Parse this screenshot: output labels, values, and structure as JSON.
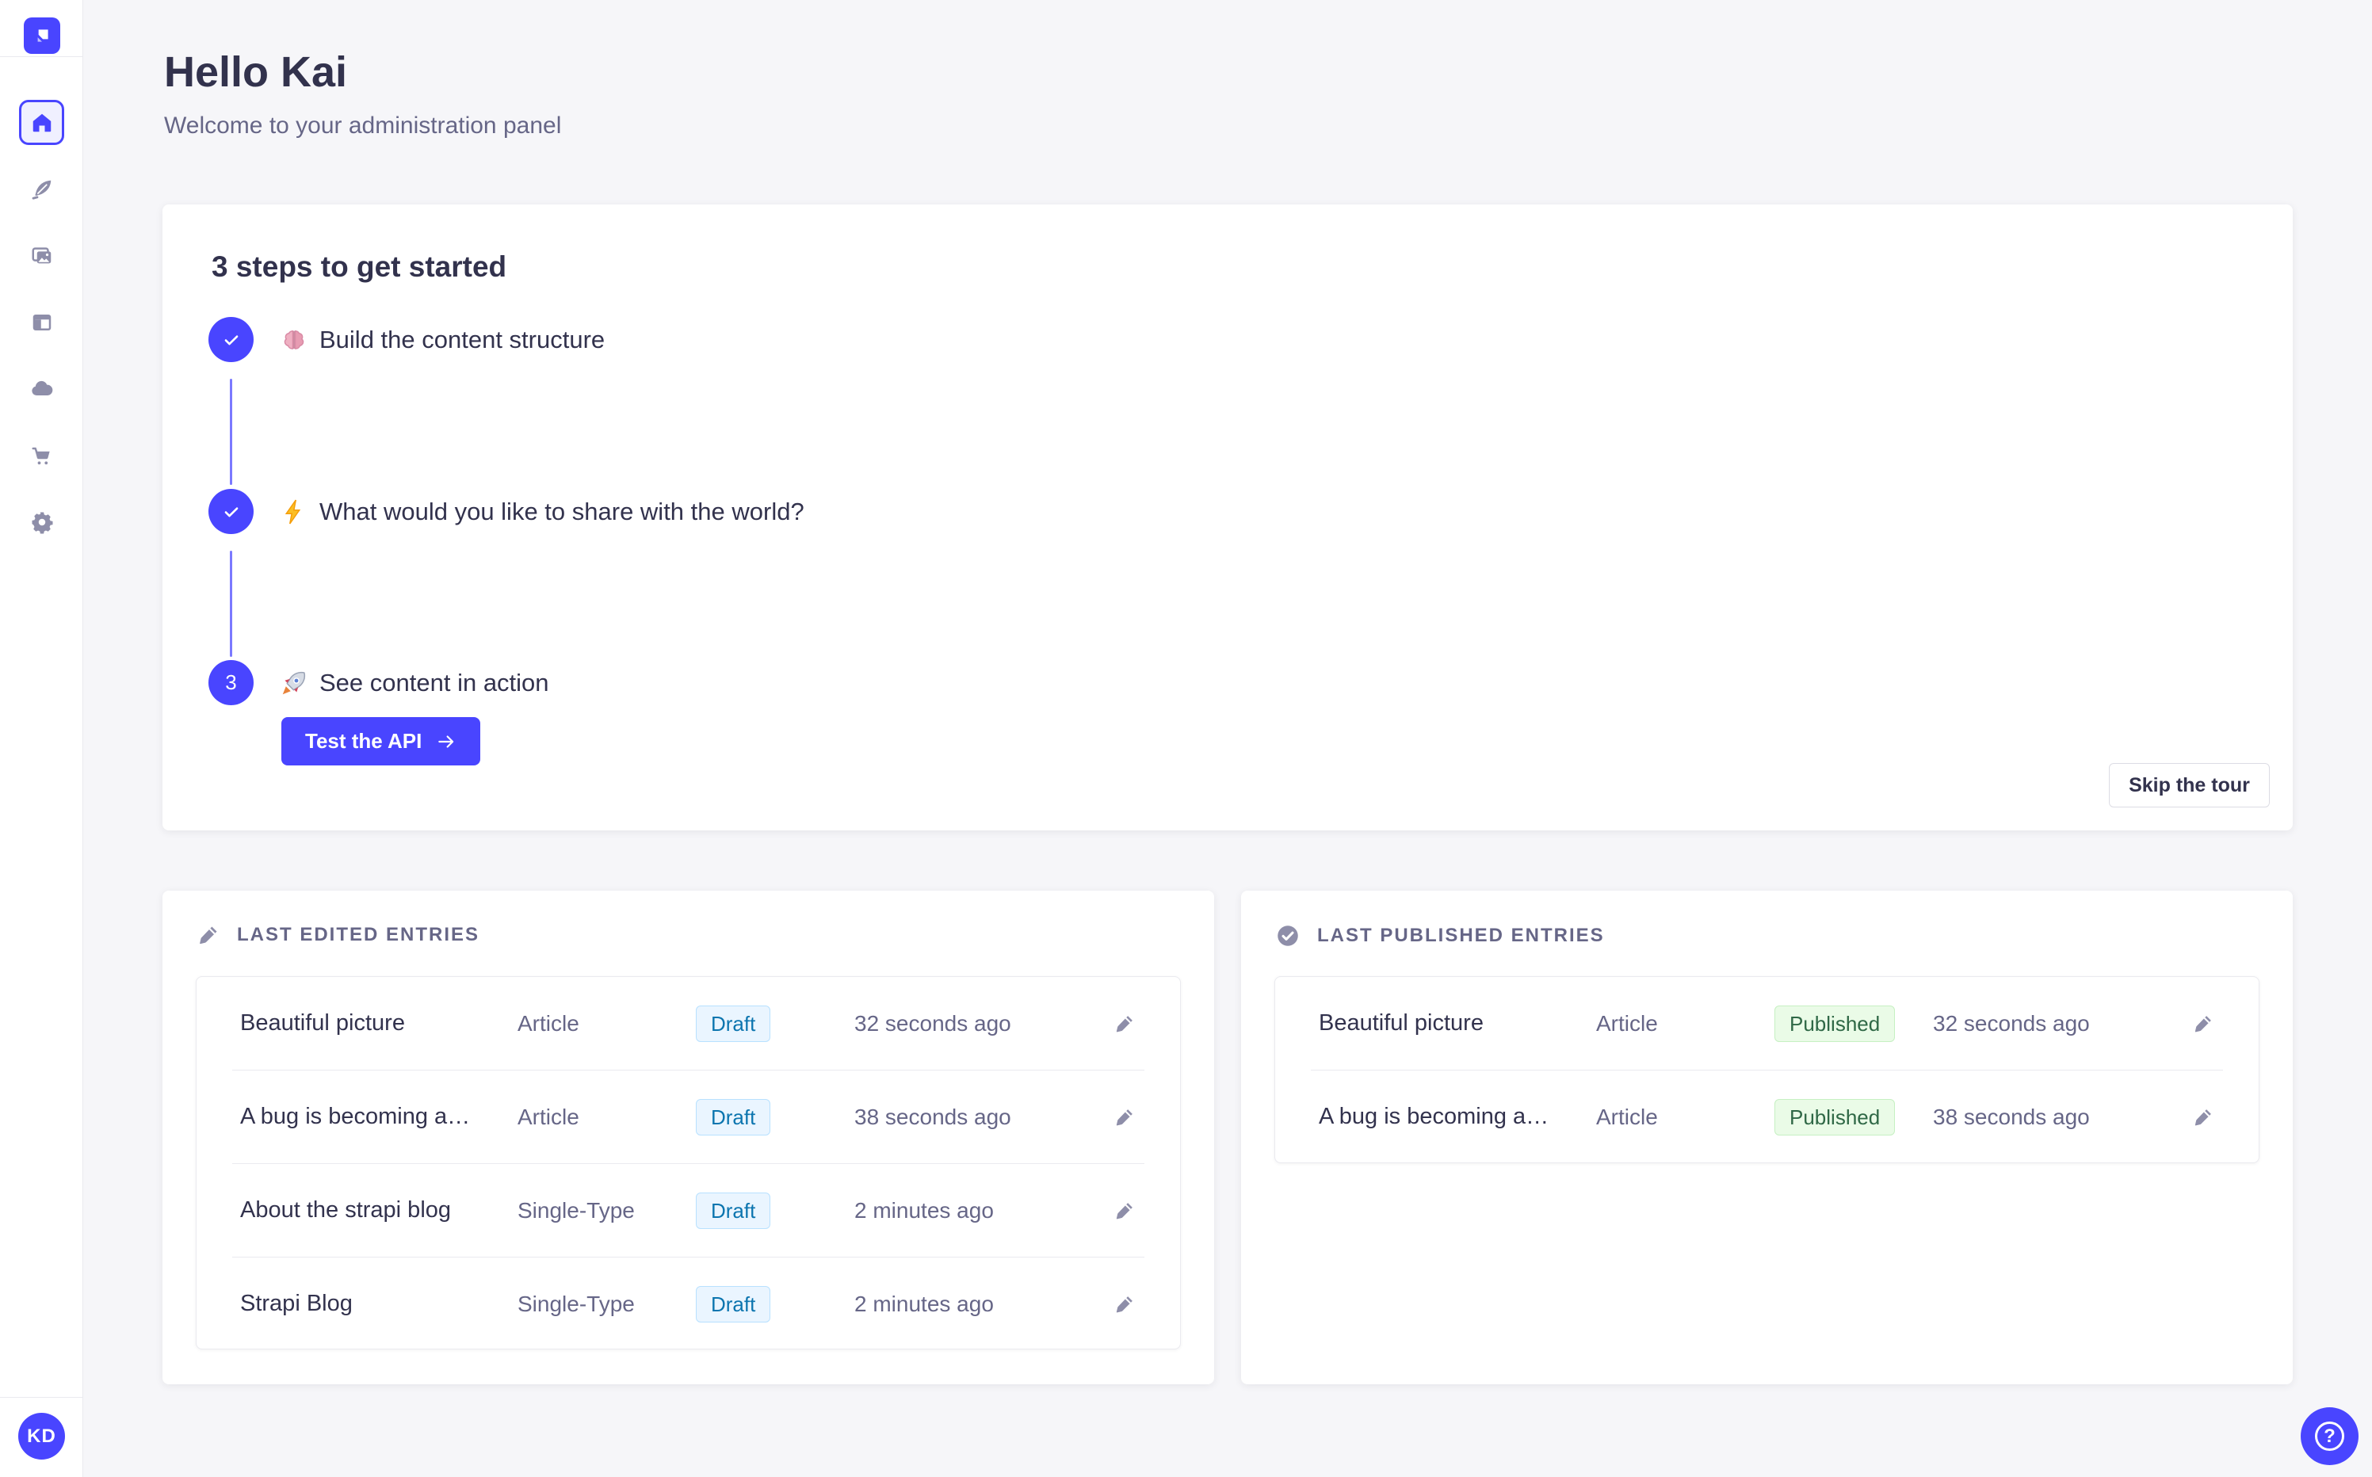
{
  "header": {
    "title": "Hello Kai",
    "subtitle": "Welcome to your administration panel"
  },
  "sidebar": {
    "logo_icon": "strapi-logo",
    "items": [
      {
        "icon": "home-icon",
        "active": true
      },
      {
        "icon": "feather-icon",
        "active": false
      },
      {
        "icon": "images-icon",
        "active": false
      },
      {
        "icon": "layout-icon",
        "active": false
      },
      {
        "icon": "cloud-icon",
        "active": false
      },
      {
        "icon": "cart-icon",
        "active": false
      },
      {
        "icon": "gear-icon",
        "active": false
      }
    ],
    "avatar_initials": "KD"
  },
  "onboarding": {
    "title": "3 steps to get started",
    "steps": [
      {
        "status": "done",
        "emoji": "🧠",
        "emoji_name": "brain",
        "label": "Build the content structure"
      },
      {
        "status": "done",
        "emoji": "⚡",
        "emoji_name": "zap",
        "label": "What would you like to share with the world?"
      },
      {
        "status": "current",
        "number": "3",
        "emoji": "🚀",
        "emoji_name": "rocket",
        "label": "See content in action"
      }
    ],
    "cta_label": "Test the API",
    "skip_label": "Skip the tour"
  },
  "edited": {
    "title": "LAST EDITED ENTRIES",
    "rows": [
      {
        "title": "Beautiful picture",
        "type": "Article",
        "status": "Draft",
        "time": "32 seconds ago"
      },
      {
        "title": "A bug is becoming a…",
        "type": "Article",
        "status": "Draft",
        "time": "38 seconds ago"
      },
      {
        "title": "About the strapi blog",
        "type": "Single-Type",
        "status": "Draft",
        "time": "2 minutes ago"
      },
      {
        "title": "Strapi Blog",
        "type": "Single-Type",
        "status": "Draft",
        "time": "2 minutes ago"
      }
    ]
  },
  "published": {
    "title": "LAST PUBLISHED ENTRIES",
    "rows": [
      {
        "title": "Beautiful picture",
        "type": "Article",
        "status": "Published",
        "time": "32 seconds ago"
      },
      {
        "title": "A bug is becoming a…",
        "type": "Article",
        "status": "Published",
        "time": "38 seconds ago"
      }
    ]
  },
  "help": {
    "icon_glyph": "?"
  },
  "colors": {
    "accent": "#4945ff",
    "connector": "#7b79ff",
    "page_bg": "#f6f6f9",
    "text_dark": "#32324d",
    "text_muted": "#666687",
    "icon_muted": "#8e8ea9",
    "draft_bg": "#eaf5ff",
    "draft_border": "#b8e1ff",
    "draft_text": "#0c75af",
    "published_bg": "#eafbe7",
    "published_border": "#c6f0c2",
    "published_text": "#2f6846"
  }
}
